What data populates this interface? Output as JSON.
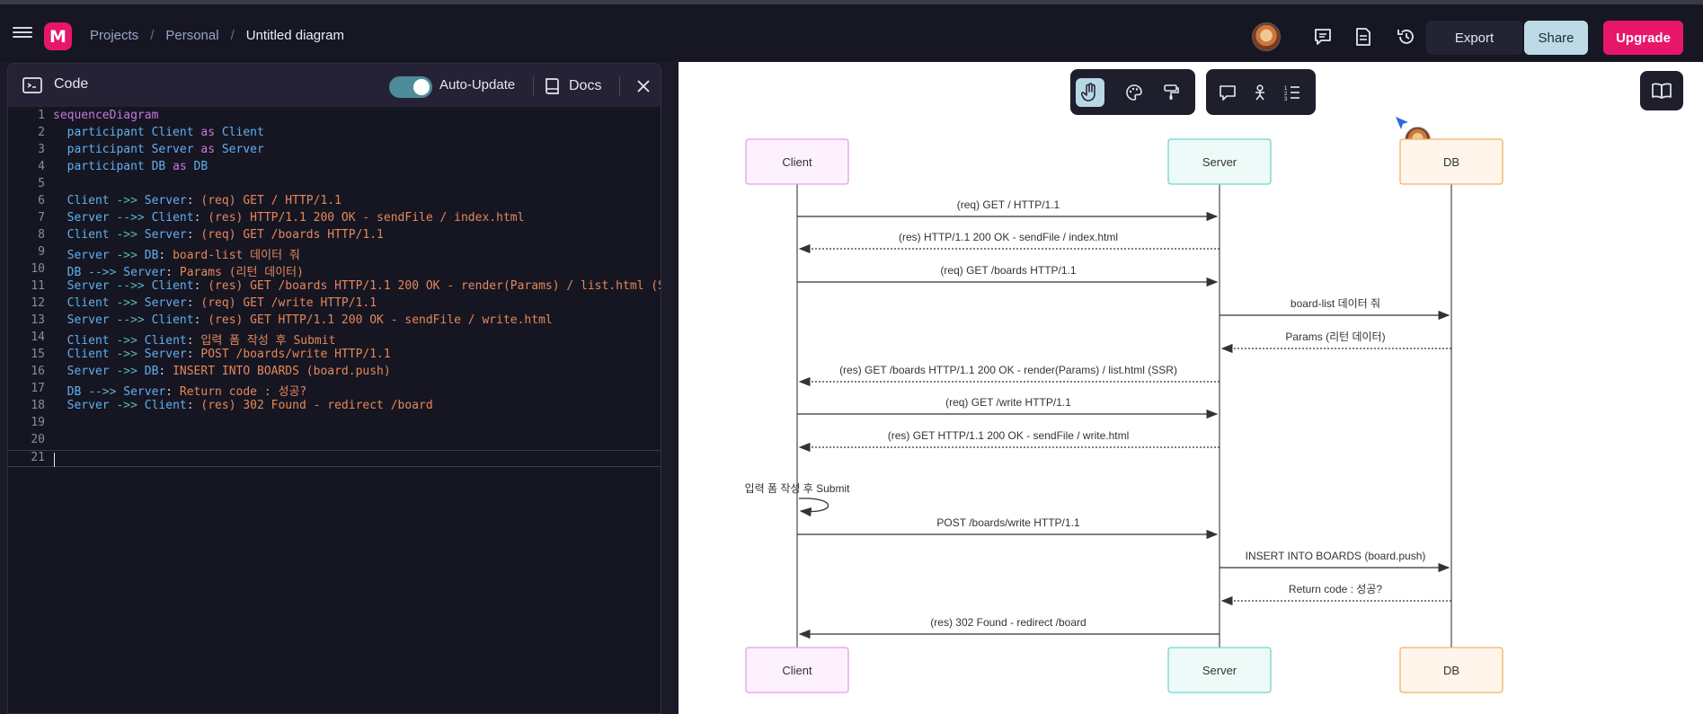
{
  "header": {
    "breadcrumb": [
      "Projects",
      "Personal",
      "Untitled diagram"
    ],
    "breadcrumb_separator": "/",
    "logo_letter": "M",
    "export_label": "Export",
    "share_label": "Share",
    "upgrade_label": "Upgrade"
  },
  "code_panel": {
    "title": "Code",
    "auto_update_label": "Auto-Update",
    "auto_update_on": true,
    "docs_label": "Docs",
    "lines": [
      {
        "n": "1",
        "text": "sequenceDiagram"
      },
      {
        "n": "2",
        "text": "  participant Client as Client"
      },
      {
        "n": "3",
        "text": "  participant Server as Server"
      },
      {
        "n": "4",
        "text": "  participant DB as DB"
      },
      {
        "n": "5",
        "text": ""
      },
      {
        "n": "6",
        "text": "  Client ->> Server: (req) GET / HTTP/1.1"
      },
      {
        "n": "7",
        "text": "  Server -->> Client: (res) HTTP/1.1 200 OK - sendFile / index.html"
      },
      {
        "n": "8",
        "text": "  Client ->> Server: (req) GET /boards HTTP/1.1"
      },
      {
        "n": "9",
        "text": "  Server ->> DB: board-list 데이터 줘"
      },
      {
        "n": "10",
        "text": "  DB -->> Server: Params (리턴 데이터)"
      },
      {
        "n": "11",
        "text": "  Server -->> Client: (res) GET /boards HTTP/1.1 200 OK - render(Params) / list.html (SS"
      },
      {
        "n": "12",
        "text": "  Client ->> Server: (req) GET /write HTTP/1.1"
      },
      {
        "n": "13",
        "text": "  Server -->> Client: (res) GET HTTP/1.1 200 OK - sendFile / write.html"
      },
      {
        "n": "14",
        "text": "  Client ->> Client: 입력 폼 작성 후 Submit"
      },
      {
        "n": "15",
        "text": "  Client ->> Server: POST /boards/write HTTP/1.1"
      },
      {
        "n": "16",
        "text": "  Server ->> DB: INSERT INTO BOARDS (board.push)"
      },
      {
        "n": "17",
        "text": "  DB -->> Server: Return code : 성공?"
      },
      {
        "n": "18",
        "text": "  Server ->> Client: (res) 302 Found - redirect /board"
      },
      {
        "n": "19",
        "text": ""
      },
      {
        "n": "20",
        "text": ""
      },
      {
        "n": "21",
        "text": ""
      }
    ]
  },
  "toolbar": {
    "left_group": [
      "hand-icon",
      "palette-icon",
      "paint-roller-icon"
    ],
    "right_group": [
      "comment-icon",
      "actor-icon",
      "list-icon"
    ],
    "active": "hand-icon"
  },
  "top_icons": [
    "chat-icon",
    "document-icon",
    "history-icon",
    "book-icon"
  ],
  "colors": {
    "accent": "#e8166a",
    "share_bg": "#bcdbe6",
    "client": "#e99bf0",
    "server": "#6fd6c9",
    "db": "#f4b169"
  },
  "diagram": {
    "participants": [
      {
        "id": "client",
        "label": "Client"
      },
      {
        "id": "server",
        "label": "Server"
      },
      {
        "id": "db",
        "label": "DB"
      }
    ],
    "messages": [
      {
        "from": "client",
        "to": "server",
        "dashed": false,
        "text": "(req) GET / HTTP/1.1"
      },
      {
        "from": "server",
        "to": "client",
        "dashed": true,
        "text": "(res) HTTP/1.1 200 OK - sendFile / index.html"
      },
      {
        "from": "client",
        "to": "server",
        "dashed": false,
        "text": "(req) GET /boards HTTP/1.1"
      },
      {
        "from": "server",
        "to": "db",
        "dashed": false,
        "text": "board-list 데이터 줘"
      },
      {
        "from": "db",
        "to": "server",
        "dashed": true,
        "text": "Params (리턴 데이터)"
      },
      {
        "from": "server",
        "to": "client",
        "dashed": true,
        "text": "(res) GET /boards HTTP/1.1 200 OK - render(Params) / list.html (SSR)"
      },
      {
        "from": "client",
        "to": "server",
        "dashed": false,
        "text": "(req) GET /write HTTP/1.1"
      },
      {
        "from": "server",
        "to": "client",
        "dashed": true,
        "text": "(res) GET HTTP/1.1 200 OK - sendFile / write.html"
      },
      {
        "from": "client",
        "to": "client",
        "dashed": false,
        "text": "입력 폼 작성 후 Submit"
      },
      {
        "from": "client",
        "to": "server",
        "dashed": false,
        "text": "POST /boards/write HTTP/1.1"
      },
      {
        "from": "server",
        "to": "db",
        "dashed": false,
        "text": "INSERT INTO BOARDS (board.push)"
      },
      {
        "from": "db",
        "to": "server",
        "dashed": true,
        "text": "Return code : 성공?"
      },
      {
        "from": "server",
        "to": "client",
        "dashed": false,
        "text": "(res) 302 Found - redirect /board"
      }
    ]
  }
}
